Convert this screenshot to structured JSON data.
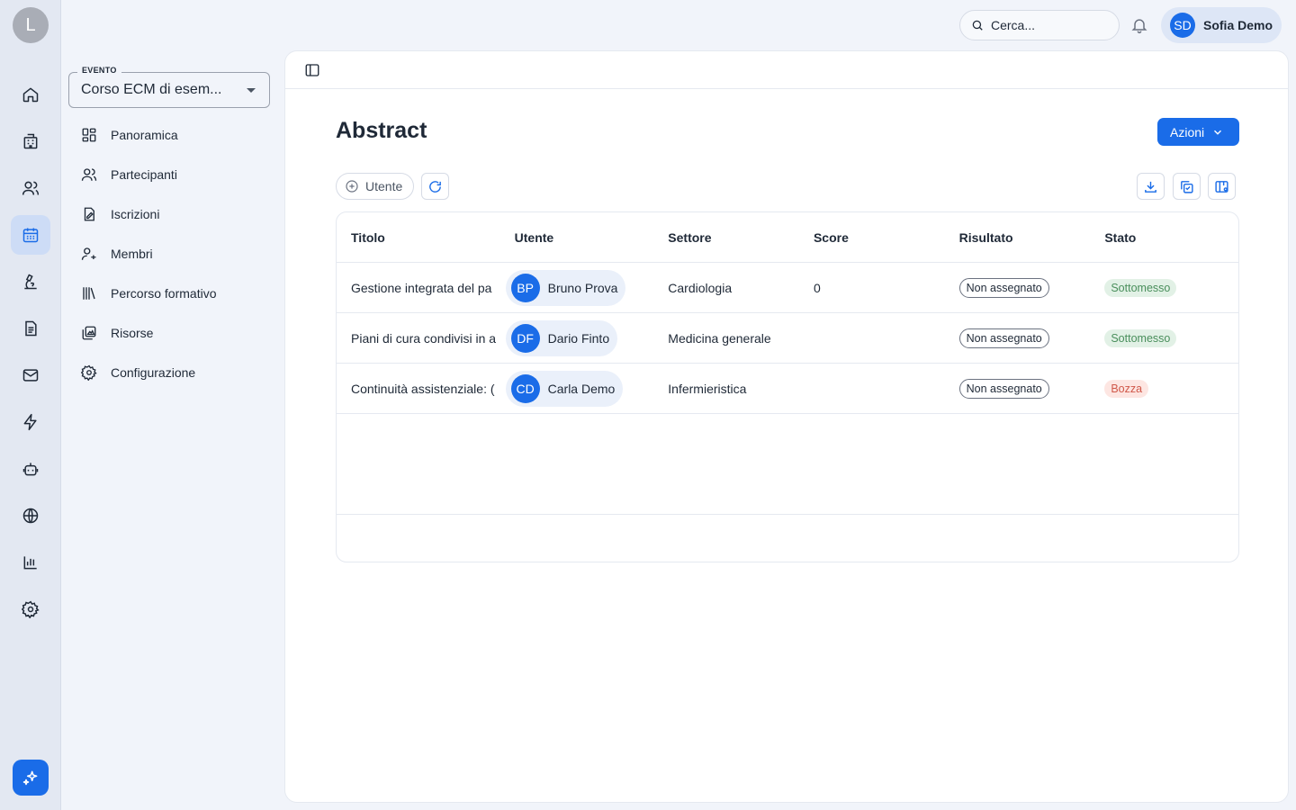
{
  "rail": {
    "logo_letter": "L",
    "items": [
      {
        "icon": "home-icon"
      },
      {
        "icon": "building-icon"
      },
      {
        "icon": "users-icon"
      },
      {
        "icon": "calendar-icon",
        "active": true
      },
      {
        "icon": "microscope-icon"
      },
      {
        "icon": "document-icon"
      },
      {
        "icon": "mail-icon"
      },
      {
        "icon": "lightning-icon"
      },
      {
        "icon": "robot-icon"
      },
      {
        "icon": "globe-icon"
      },
      {
        "icon": "bar-chart-icon"
      },
      {
        "icon": "gear-icon"
      }
    ],
    "ai_icon": "sparkles-icon"
  },
  "topbar": {
    "search_placeholder": "Cerca...",
    "bell_icon": "bell-icon",
    "user": {
      "initials": "SD",
      "name": "Sofia Demo"
    }
  },
  "sidebar": {
    "event_legend": "EVENTO",
    "event_value": "Corso ECM di esem...",
    "items": [
      {
        "label": "Panoramica",
        "icon": "dashboard-icon"
      },
      {
        "label": "Partecipanti",
        "icon": "participants-icon"
      },
      {
        "label": "Iscrizioni",
        "icon": "registration-icon"
      },
      {
        "label": "Membri",
        "icon": "member-icon"
      },
      {
        "label": "Percorso formativo",
        "icon": "library-icon"
      },
      {
        "label": "Risorse",
        "icon": "resources-icon"
      },
      {
        "label": "Configurazione",
        "icon": "settings-icon"
      }
    ]
  },
  "main": {
    "title": "Abstract",
    "actions_label": "Azioni",
    "add_user_label": "Utente",
    "columns": [
      "Titolo",
      "Utente",
      "Settore",
      "Score",
      "Risultato",
      "Stato"
    ],
    "rows": [
      {
        "titolo": "Gestione integrata del pa",
        "initials": "BP",
        "utente": "Bruno Prova",
        "settore": "Cardiologia",
        "score": "0",
        "risultato": "Non assegnato",
        "stato": "Sottomesso",
        "stato_kind": "green"
      },
      {
        "titolo": "Piani di cura condivisi in a",
        "initials": "DF",
        "utente": "Dario Finto",
        "settore": "Medicina generale",
        "score": "",
        "risultato": "Non assegnato",
        "stato": "Sottomesso",
        "stato_kind": "green"
      },
      {
        "titolo": "Continuità assistenziale: (",
        "initials": "CD",
        "utente": "Carla Demo",
        "settore": "Infermieristica",
        "score": "",
        "risultato": "Non assegnato",
        "stato": "Bozza",
        "stato_kind": "red"
      }
    ]
  },
  "colors": {
    "accent": "#1a6ce8",
    "status_green": "#4a8f5c",
    "status_red": "#d0584a"
  }
}
